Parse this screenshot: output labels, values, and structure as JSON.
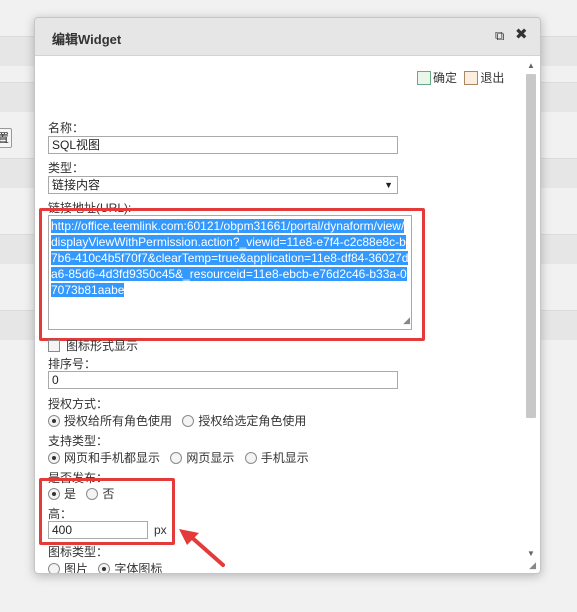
{
  "background": {
    "button_label": "置"
  },
  "dialog": {
    "title": "编辑Widget",
    "popout_icon": "popout-icon",
    "close_icon": "close-icon"
  },
  "toolbar": {
    "confirm_label": "确定",
    "exit_label": "退出"
  },
  "form": {
    "name_label": "名称：",
    "name_value": "SQL视图",
    "type_label": "类型：",
    "type_value": "链接内容",
    "url_label": "链接地址(URL):",
    "url_value": "http://office.teemlink.com:60121/obpm31661/portal/dynaform/view/displayViewWithPermission.action?_viewid=11e8-e7f4-c2c88e8c-b7b6-410c4b5f70f7&clearTemp=true&application=11e8-df84-36027da6-85d6-4d3fd9350c45&_resourceid=11e8-ebcb-e76d2c46-b33a-07073b81aabe",
    "icon_display_label": "图标形式显示",
    "order_label": "排序号：",
    "order_value": "0",
    "auth_label": "授权方式：",
    "auth_options": [
      "授权给所有角色使用",
      "授权给选定角色使用"
    ],
    "support_label": "支持类型：",
    "support_options": [
      "网页和手机都显示",
      "网页显示",
      "手机显示"
    ],
    "publish_label": "是否发布：",
    "publish_options": [
      "是",
      "否"
    ],
    "height_label": "高：",
    "height_value": "400",
    "height_unit": "px",
    "icon_type_label": "图标类型：",
    "icon_type_options": [
      "图片",
      "字体图标"
    ]
  },
  "colors": {
    "highlight_red": "#e53a3a",
    "selection_blue": "#3399ff"
  }
}
